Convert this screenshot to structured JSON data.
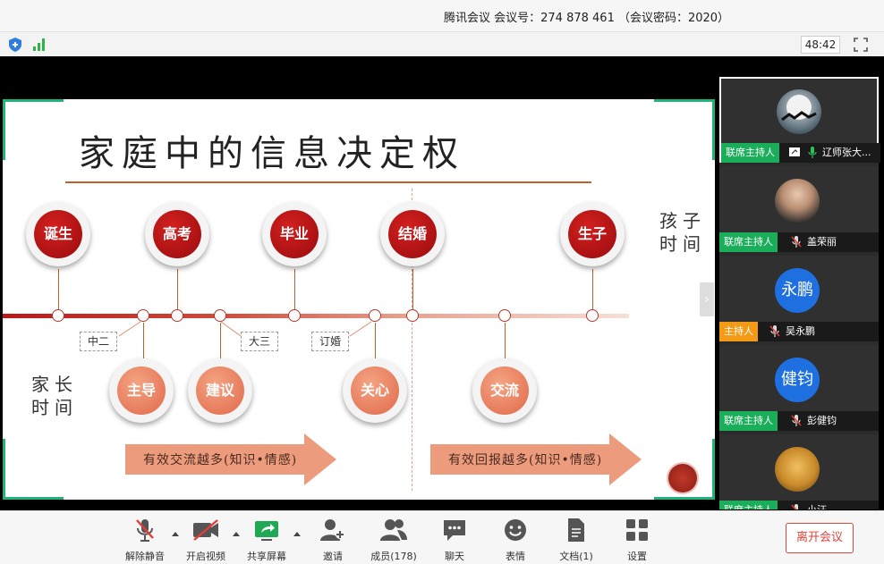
{
  "window": {
    "meeting_info": "腾讯会议 会议号：274 878 461 （会议密码：2020）"
  },
  "status": {
    "timer": "48:42"
  },
  "slide": {
    "title": "家庭中的信息决定权",
    "top_bubbles": [
      "诞生",
      "高考",
      "毕业",
      "结婚",
      "生子"
    ],
    "bottom_bubbles": [
      "主导",
      "建议",
      "关心",
      "交流"
    ],
    "tags": [
      "中二",
      "大三",
      "订婚"
    ],
    "child_label": [
      "孩子",
      "时间"
    ],
    "parent_label": [
      "家长",
      "时间"
    ],
    "arrow_left": "有效交流越多(知识•情感)",
    "arrow_right": "有效回报越多(知识•情感)",
    "colors": {
      "accent_green": "#1fb57a",
      "deep_red": "#b8191a",
      "salmon": "#ed9b7d"
    }
  },
  "participants": [
    {
      "role": "联席主持人",
      "name": "辽师张大...",
      "avatar": "night-sky-image",
      "role_color": "green"
    },
    {
      "role": "联席主持人",
      "name": "盖荣丽",
      "avatar": "woman-photo",
      "role_color": "green"
    },
    {
      "role": "主持人",
      "name": "吴永鹏",
      "avatar_text": "永鹏",
      "role_color": "orange"
    },
    {
      "role": "联席主持人",
      "name": "彭健钧",
      "avatar_text": "健钧",
      "role_color": "green"
    },
    {
      "role": "联席主持人",
      "name": "小汪...",
      "avatar": "cat-image",
      "role_color": "green"
    }
  ],
  "toolbar": {
    "mute": "解除静音",
    "video": "开启视频",
    "share": "共享屏幕",
    "invite": "邀请",
    "members": "成员(178)",
    "chat": "聊天",
    "reactions": "表情",
    "docs": "文档(1)",
    "settings": "设置",
    "leave": "离开会议"
  }
}
